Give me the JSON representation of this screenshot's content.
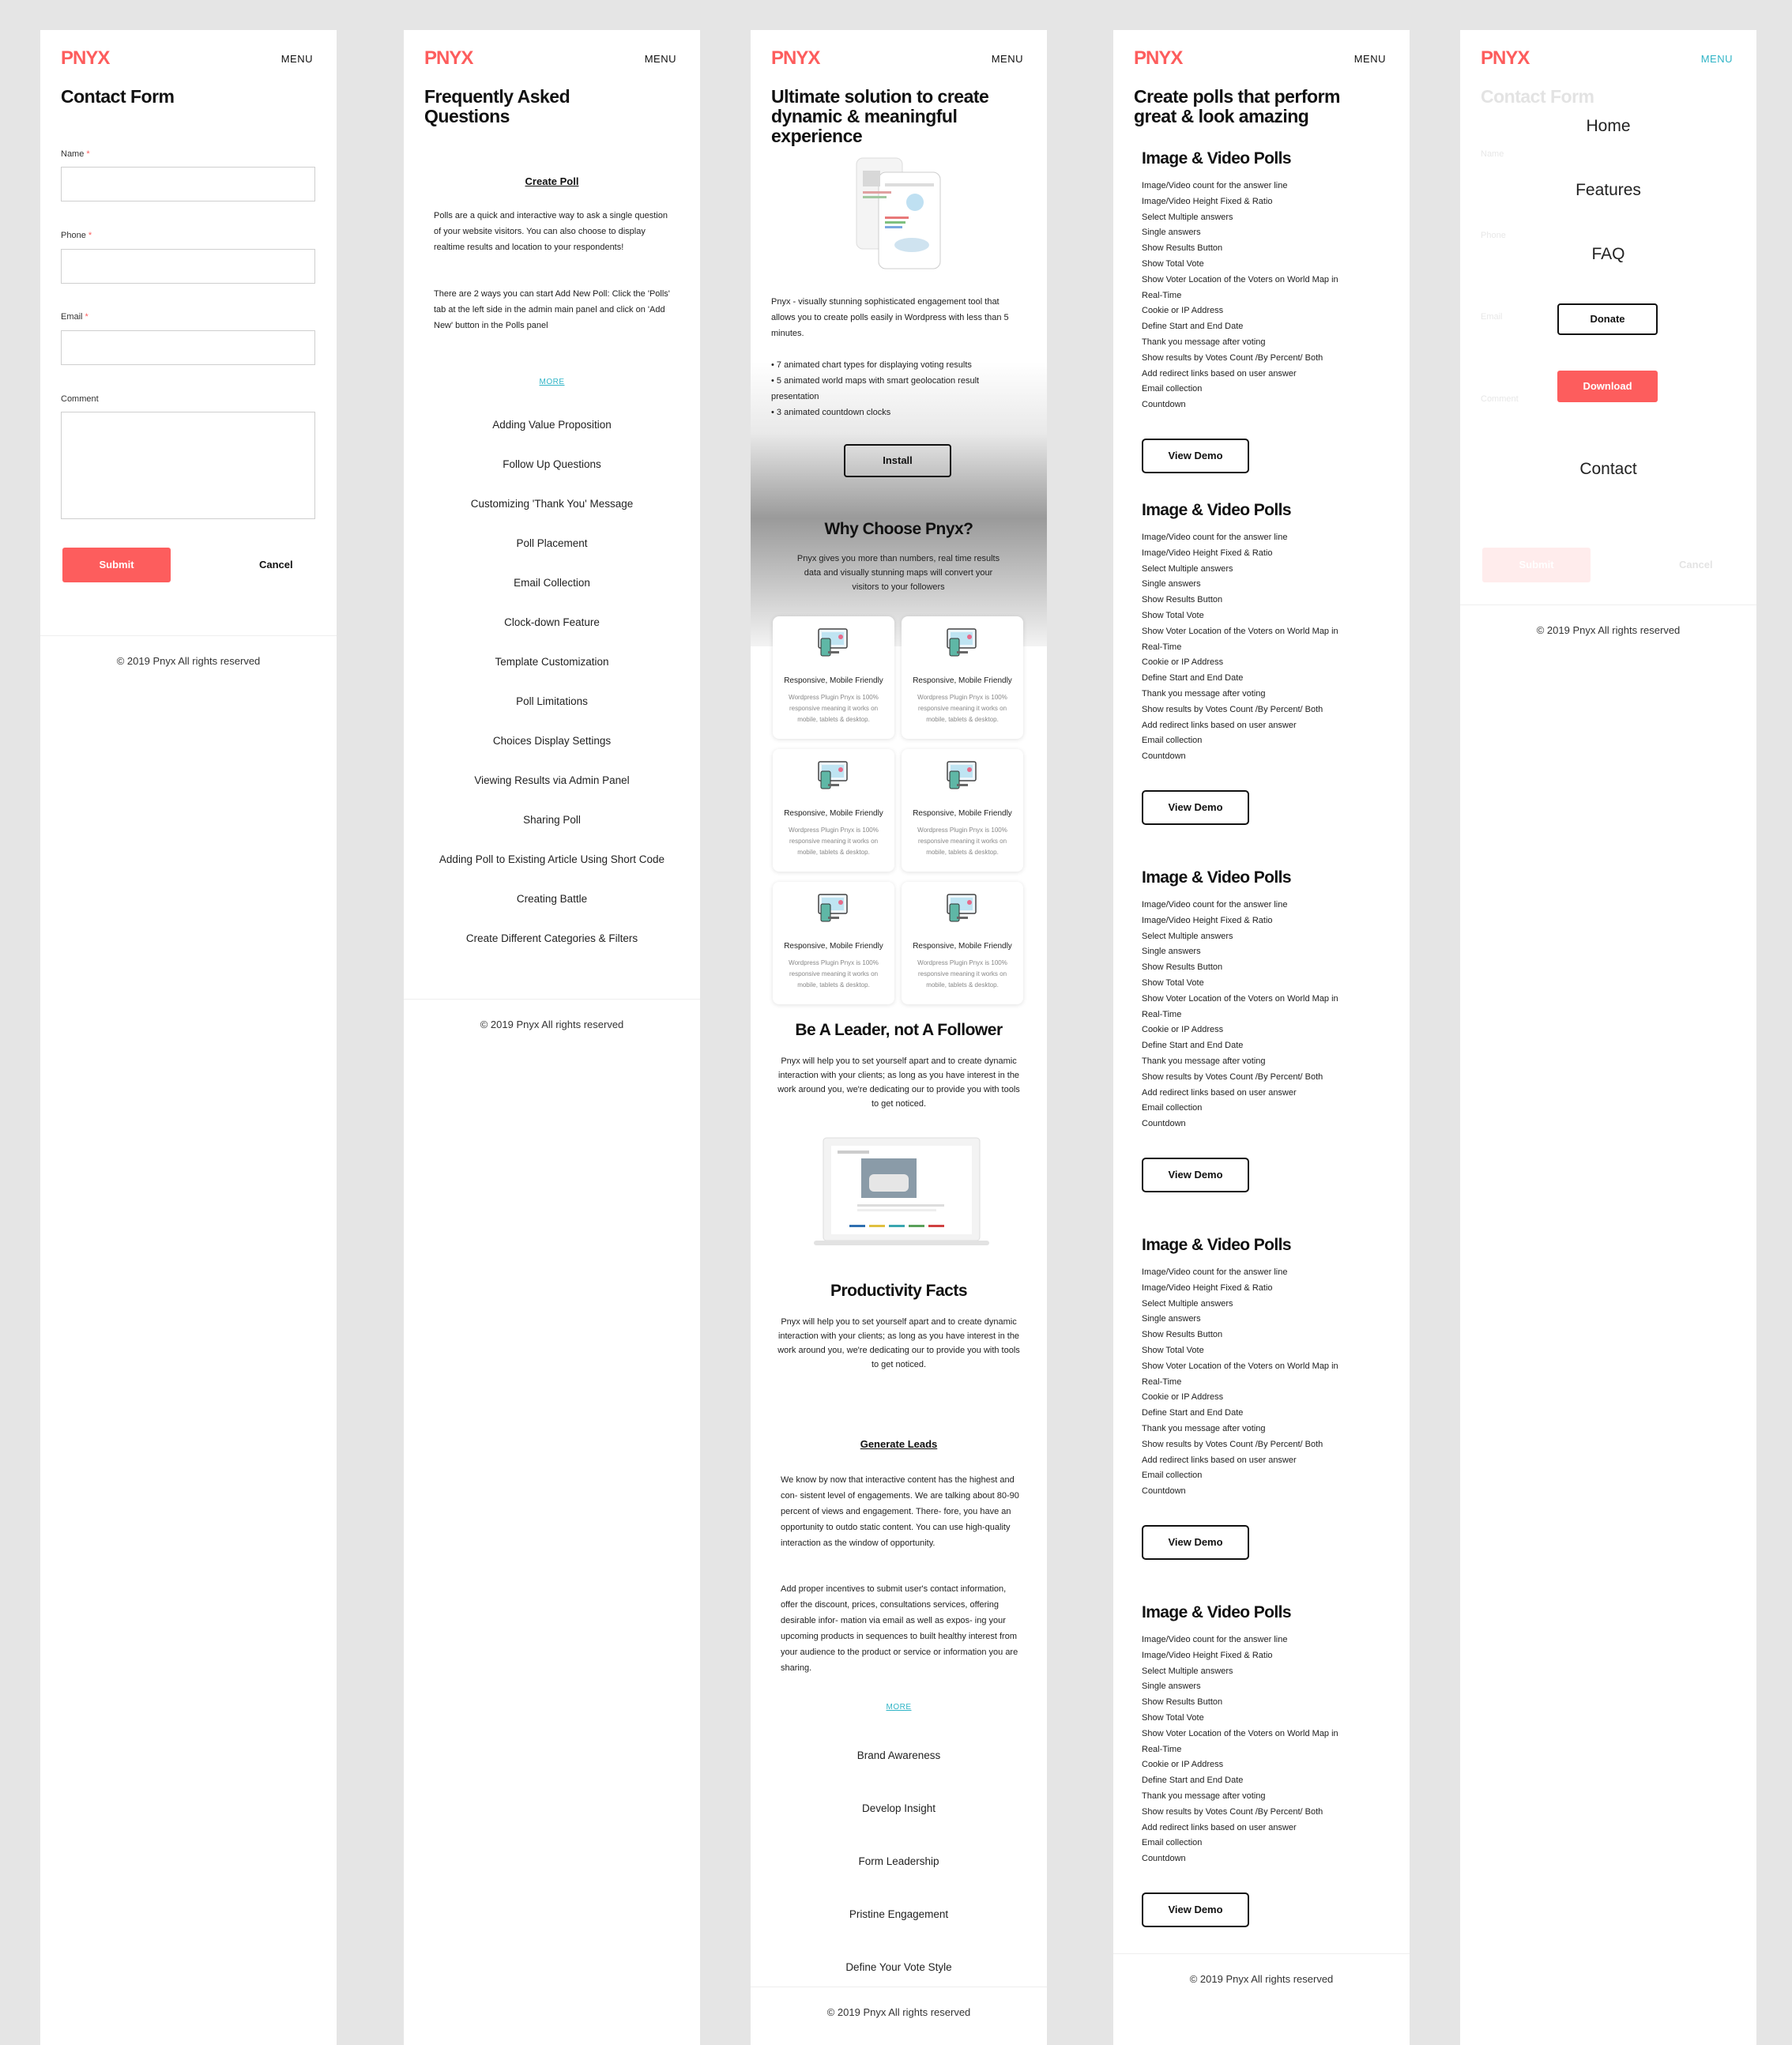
{
  "brand": {
    "logo": "PNYX",
    "menu": "MENU",
    "accent": "#fd5d5d",
    "teal": "#2fb4c6"
  },
  "footer": "© 2019 Pnyx All rights reserved",
  "contact": {
    "title": "Contact Form",
    "fields": [
      {
        "label": "Name",
        "required": "*"
      },
      {
        "label": "Phone",
        "required": "*"
      },
      {
        "label": "Email",
        "required": "*"
      },
      {
        "label": "Comment"
      }
    ],
    "submit": "Submit",
    "cancel": "Cancel"
  },
  "faq": {
    "title": "Frequently Asked Questions",
    "section": "Create Poll",
    "para1": "Polls are a quick and interactive way to ask a single question of your website visitors. You can also choose to display realtime results and location to your respondents!",
    "para2": "There are 2 ways you can start Add New Poll: Click the 'Polls' tab at the left side in the admin main panel and click on 'Add New' button in the Polls panel",
    "more": "MORE",
    "items": [
      "Adding Value Proposition",
      "Follow Up Questions",
      "Customizing 'Thank You' Message",
      "Poll Placement",
      "Email Collection",
      "Clock-down Feature",
      "Template Customization",
      "Poll Limitations",
      "Choices Display Settings",
      "Viewing Results via Admin Panel",
      "Sharing Poll",
      "Adding Poll to Existing Article Using Short Code",
      "Creating Battle",
      "Create Different Categories & Filters"
    ]
  },
  "home": {
    "title": "Ultimate solution to create dynamic & meaningful experience",
    "intro": "Pnyx - visually stunning sophisticated engagement tool that allows you to create polls easily in Wordpress with less than 5 minutes.",
    "bullets": [
      "• 7 animated chart types for displaying voting results",
      "• 5 animated world maps with smart geolocation result presentation",
      "• 3 animated countdown clocks"
    ],
    "install": "Install",
    "why_title": "Why Choose Pnyx?",
    "why_text": "Pnyx gives you more than numbers, real time results data and visually stunning maps will convert your visitors to your followers",
    "card_title": "Responsive, Mobile Friendly",
    "card_text": "Wordpress Plugin Pnyx is 100% responsive meaning it works on mobile, tablets & desktop.",
    "cards_icon": "responsive-devices-icon",
    "leader_title": "Be A Leader, not A Follower",
    "leader_text": "Pnyx will help you to set yourself apart and to create dynamic interaction with your clients; as long as you have interest in the work around you, we're dedicating our to provide you with tools to get noticed.",
    "facts_title": "Productivity Facts",
    "facts_text": "Pnyx will help you to set yourself apart and to create dynamic interaction with your clients; as long as you have interest in the work around you, we're dedicating our to provide you with tools to get noticed.",
    "leads_title": "Generate Leads",
    "leads_p1": "We know by now that interactive content has the highest and con- sistent level of engagements. We are talking about 80-90 percent of views and engagement. There- fore, you have an opportunity to outdo static content. You can use high-quality interaction as the window of opportunity.",
    "leads_p2": "Add proper incentives to submit user's contact information, offer the discount, prices, consultations services, offering desirable infor- mation via email as well as expos- ing your upcoming products in sequences to built healthy interest from your audience to the product or service or information you are sharing.",
    "more": "MORE",
    "items": [
      "Brand Awareness",
      "Develop Insight",
      "Form Leadership",
      "Pristine Engagement",
      "Define Your Vote Style"
    ]
  },
  "features": {
    "title": "Create polls that perform great & look amazing",
    "block_title": "Image & Video Polls",
    "lines": [
      "Image/Video count for the answer line",
      "Image/Video Height  Fixed & Ratio",
      "Select Multiple answers",
      "Single answers",
      "Show Results Button",
      "Show Total Vote",
      "Show Voter Location of the Voters on World Map in",
      "Real-Time",
      "Cookie or IP Address",
      "Define Start and End Date",
      "Thank you message after voting",
      "Show results by Votes Count /By Percent/ Both",
      "Add redirect links based on user answer",
      "Email collection",
      "Countdown"
    ],
    "demo": "View Demo"
  },
  "nav": {
    "items": [
      "Home",
      "Features",
      "FAQ"
    ],
    "donate": "Donate",
    "download": "Download",
    "contact": "Contact"
  }
}
